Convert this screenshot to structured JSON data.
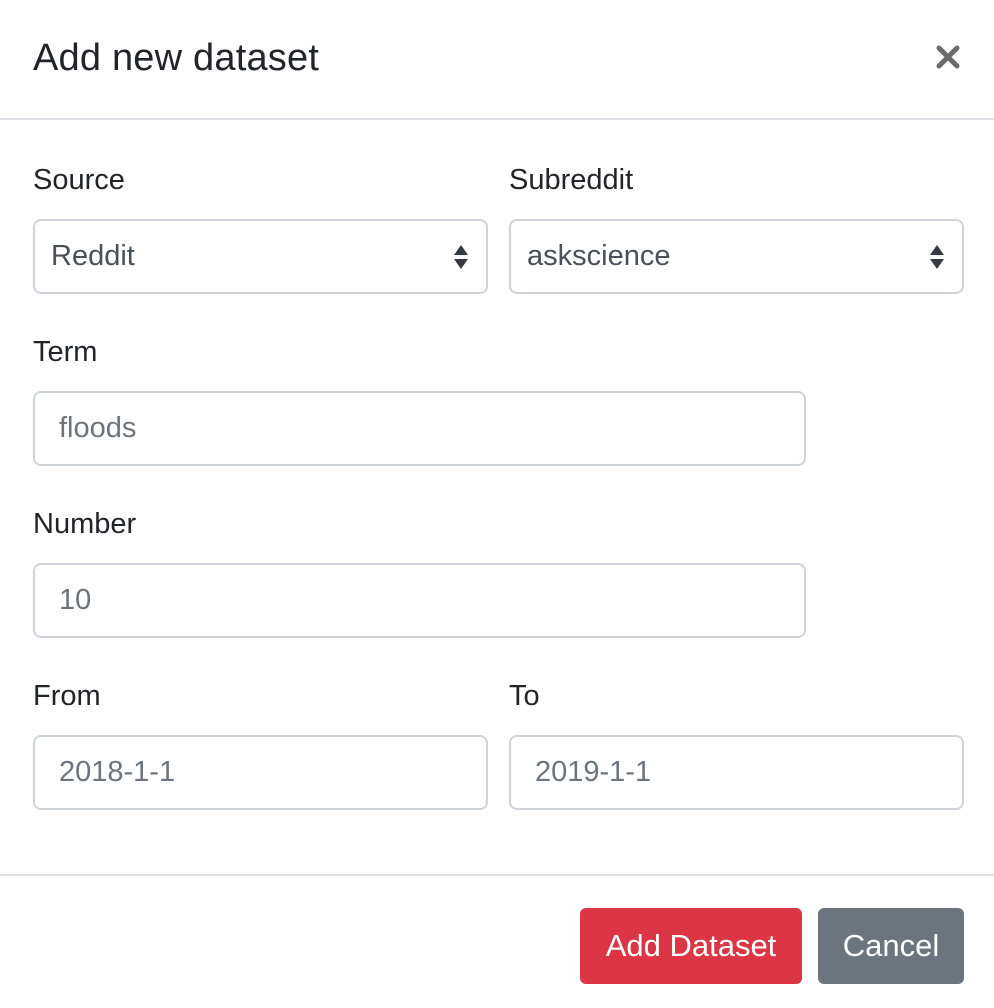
{
  "modal": {
    "title": "Add new dataset",
    "close_symbol": "×"
  },
  "form": {
    "source": {
      "label": "Source",
      "selected": "Reddit"
    },
    "subreddit": {
      "label": "Subreddit",
      "selected": "askscience"
    },
    "term": {
      "label": "Term",
      "placeholder": "floods"
    },
    "number": {
      "label": "Number",
      "placeholder": "10"
    },
    "from": {
      "label": "From",
      "placeholder": "2018-1-1"
    },
    "to": {
      "label": "To",
      "placeholder": "2019-1-1"
    }
  },
  "footer": {
    "add_label": "Add Dataset",
    "cancel_label": "Cancel"
  },
  "icons": {
    "close": "close-icon",
    "select_arrows": "select-arrows-icon"
  },
  "colors": {
    "danger": "#dc3545",
    "secondary": "#6c757d",
    "border": "#ced4da",
    "divider": "#dee2e6",
    "text": "#212529"
  }
}
